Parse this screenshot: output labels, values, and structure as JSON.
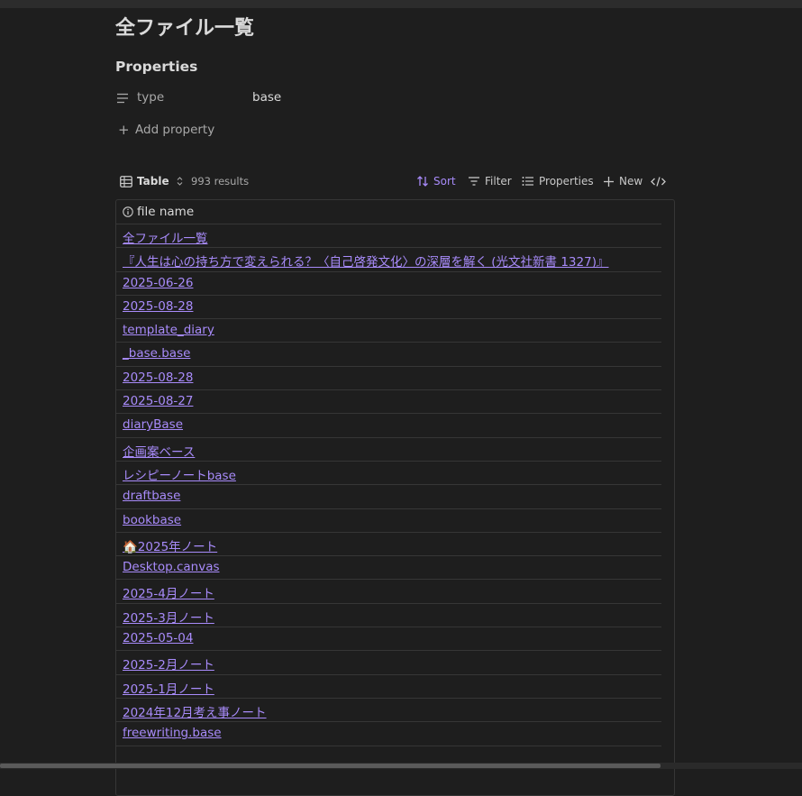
{
  "page": {
    "title": "全ファイル一覧",
    "properties_heading": "Properties",
    "property": {
      "key": "type",
      "value": "base"
    },
    "add_property_label": "Add property"
  },
  "toolbar": {
    "view_label": "Table",
    "results": "993 results",
    "sort": "Sort",
    "filter": "Filter",
    "properties": "Properties",
    "new": "New",
    "accent": "#a88bfa"
  },
  "table": {
    "header": "file name",
    "rows": [
      "全ファイル一覧",
      "『人生は心の持ち方で変えられる？〈自己啓発文化〉の深層を解く (光文社新書 1327)』",
      "2025-06-26",
      "2025-08-28",
      "template_diary",
      "_base.base",
      "2025-08-28",
      "2025-08-27",
      "diaryBase",
      "企画案ベース",
      "レシピーノートbase",
      "draftbase",
      "bookbase",
      "🏠2025年ノート",
      "Desktop.canvas",
      "2025-4月ノート",
      "2025-3月ノート",
      "2025-05-04",
      "2025-2月ノート",
      "2025-1月ノート",
      "2024年12月考え事ノート",
      "freewriting.base"
    ]
  }
}
